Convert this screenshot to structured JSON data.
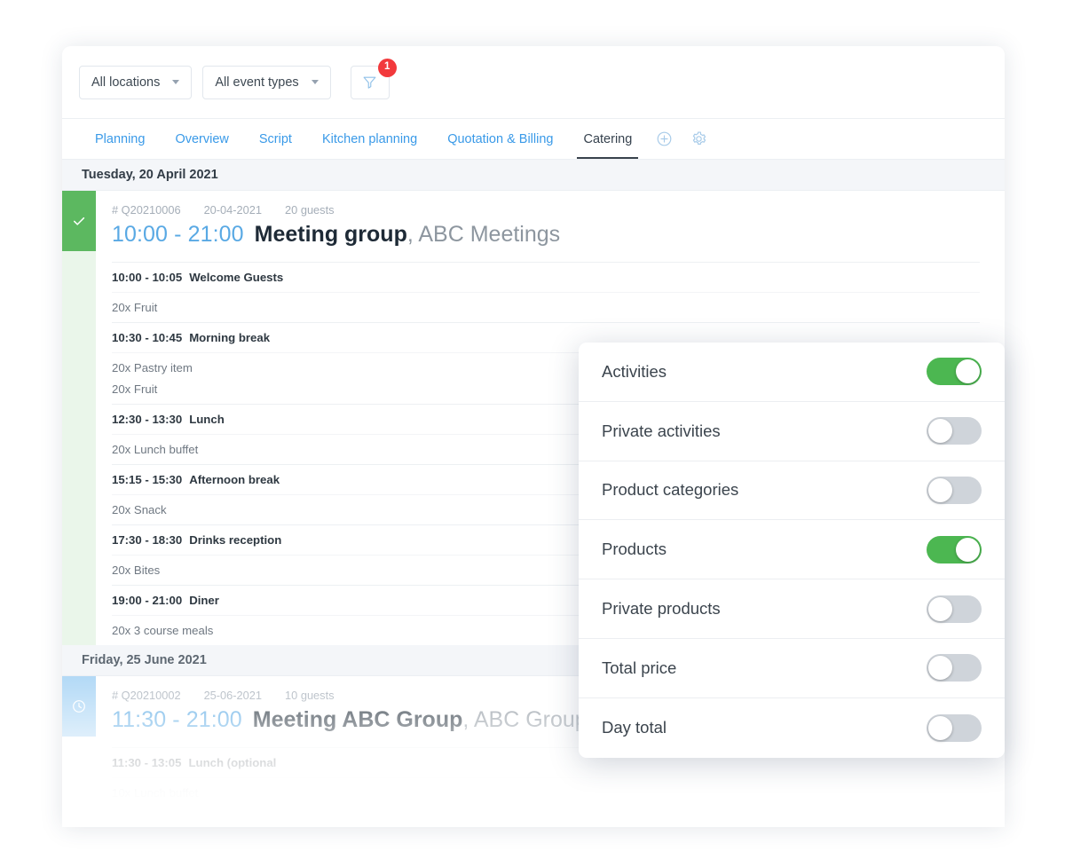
{
  "toolbar": {
    "location_filter": {
      "label": "All locations",
      "icon": "chevron-down-icon"
    },
    "event_type_filter": {
      "label": "All event types",
      "icon": "chevron-down-icon"
    },
    "filter_button": {
      "icon": "funnel-icon",
      "badge": "1"
    }
  },
  "tabs": [
    {
      "label": "Planning",
      "active": false
    },
    {
      "label": "Overview",
      "active": false
    },
    {
      "label": "Script",
      "active": false
    },
    {
      "label": "Kitchen planning",
      "active": false
    },
    {
      "label": "Quotation & Billing",
      "active": false
    },
    {
      "label": "Catering",
      "active": true
    }
  ],
  "tab_actions": [
    {
      "icon": "plus-circle-icon"
    },
    {
      "icon": "gear-icon"
    }
  ],
  "days": [
    {
      "date_label": "Tuesday, 20 April 2021",
      "event": {
        "status": "confirmed",
        "status_icon": "check-icon",
        "reference": "# Q20210006",
        "date": "20-04-2021",
        "guests": "20 guests",
        "time_range": "10:00 - 21:00",
        "name": "Meeting group",
        "organisation": ", ABC Meetings",
        "schedule": [
          {
            "type": "activity",
            "time": "10:00 - 10:05",
            "label": "Welcome Guests"
          },
          {
            "type": "product",
            "label": "20x Fruit"
          },
          {
            "type": "activity",
            "time": "10:30 - 10:45",
            "label": "Morning break"
          },
          {
            "type": "product",
            "label": "20x Pastry item"
          },
          {
            "type": "product",
            "label": "20x Fruit",
            "stacked": true
          },
          {
            "type": "activity",
            "time": "12:30 - 13:30",
            "label": "Lunch"
          },
          {
            "type": "product",
            "label": "20x Lunch buffet"
          },
          {
            "type": "activity",
            "time": "15:15 - 15:30",
            "label": "Afternoon break"
          },
          {
            "type": "product",
            "label": "20x Snack"
          },
          {
            "type": "activity",
            "time": "17:30 - 18:30",
            "label": "Drinks reception"
          },
          {
            "type": "product",
            "label": "20x Bites"
          },
          {
            "type": "activity",
            "time": "19:00 - 21:00",
            "label": "Diner"
          },
          {
            "type": "product",
            "label": "20x 3 course meals"
          }
        ]
      }
    },
    {
      "date_label": "Friday, 25 June 2021",
      "event": {
        "status": "pending",
        "status_icon": "clock-icon",
        "reference": "# Q20210002",
        "date": "25-06-2021",
        "guests": "10 guests",
        "time_range": "11:30 - 21:00",
        "name": "Meeting ABC Group",
        "organisation": ", ABC Group",
        "schedule": [
          {
            "type": "activity",
            "time": "11:30 - 13:05",
            "label": "Lunch (optional"
          },
          {
            "type": "product",
            "label": "10x Lunch buffet"
          }
        ]
      }
    }
  ],
  "settings_panel": {
    "rows": [
      {
        "label": "Activities",
        "on": true
      },
      {
        "label": "Private activities",
        "on": false
      },
      {
        "label": "Product categories",
        "on": false
      },
      {
        "label": "Products",
        "on": true
      },
      {
        "label": "Private products",
        "on": false
      },
      {
        "label": "Total price",
        "on": false
      },
      {
        "label": "Day total",
        "on": false
      }
    ]
  },
  "colors": {
    "accent_blue": "#3a9ae8",
    "status_green": "#5cb860",
    "status_blue": "#a8d4f5",
    "toggle_on": "#4cb751",
    "toggle_off": "#cfd4da",
    "badge_red": "#f2393c"
  }
}
